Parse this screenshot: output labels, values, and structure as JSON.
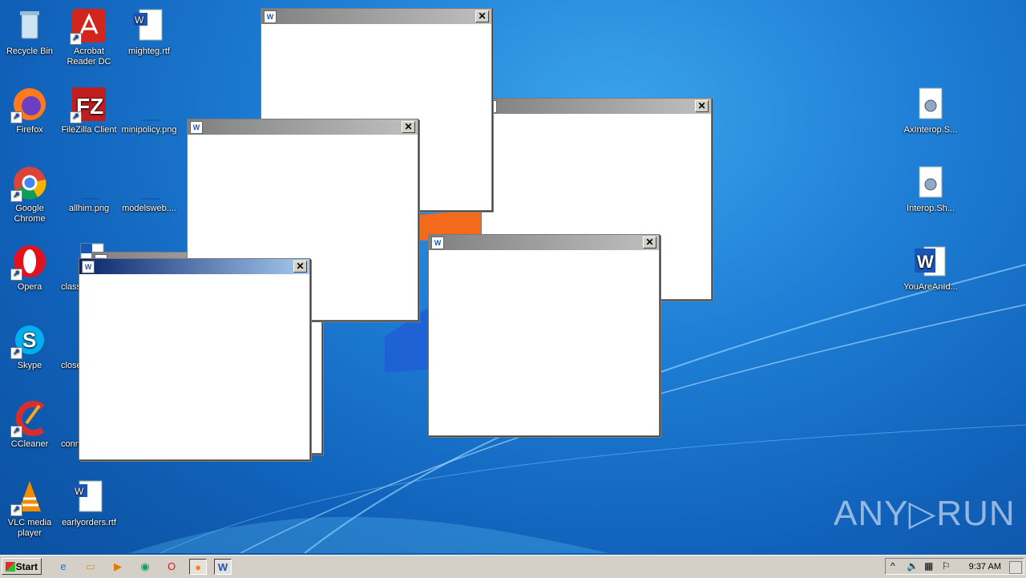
{
  "desktop_icons": {
    "recycle_bin": "Recycle Bin",
    "acrobat": "Acrobat\nReader DC",
    "mighteg": "mighteg.rtf",
    "firefox": "Firefox",
    "filezilla": "FileZilla Client",
    "minipolicy": "minipolicy.png",
    "chrome": "Google\nChrome",
    "allhim": "allhim.png",
    "modelsweb": "modelsweb....",
    "opera": "Opera",
    "class": "class",
    "skype": "Skype",
    "close": "close",
    "ccleaner": "CCleaner",
    "conn": "conn",
    "vlc": "VLC media\nplayer",
    "earlyorders": "earlyorders.rtf",
    "axinterop": "AxInterop.S...",
    "interop": "Interop.Sh...",
    "youareanid": "YouAreAnId..."
  },
  "taskbar": {
    "start_label": "Start",
    "clock": "9:37 AM"
  },
  "watermark": "ANY▷RUN",
  "colors": {
    "wallpaper": "#1f7fd6",
    "active_titlebar": "#0a246a",
    "inactive_titlebar": "#808080"
  }
}
